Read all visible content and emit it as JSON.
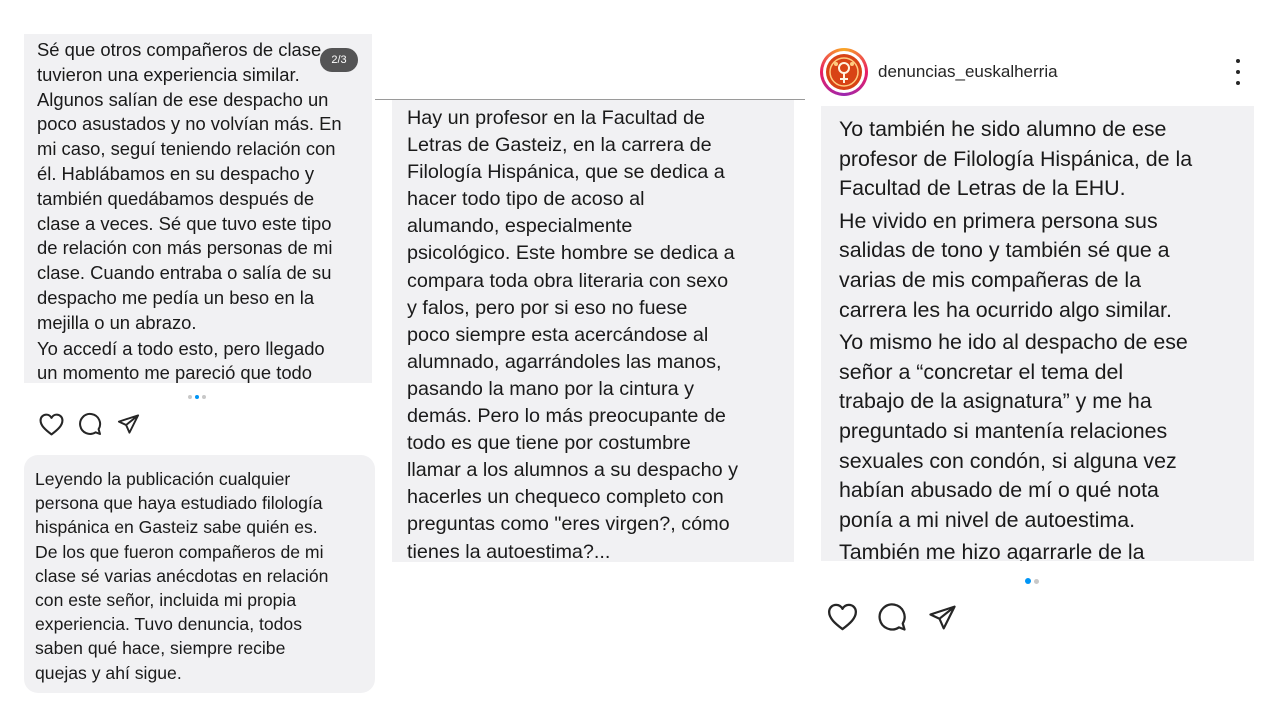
{
  "post_1": {
    "counter": "2/3",
    "text_a": "Sé que otros compañeros de clase\ntuvieron una experiencia similar.\nAlgunos salían de ese despacho un\npoco asustados y no volvían más. En\nmi caso, seguí teniendo relación con\nél. Hablábamos en su despacho y\ntambién quedábamos después de\nclase a veces. Sé que tuvo este tipo\nde relación con más personas de mi\nclase. Cuando entraba o salía de su\ndespacho me pedía un beso en la\nmejilla o un abrazo.",
    "text_b": "Yo accedí a todo esto, pero llegado\nun momento me pareció que todo",
    "carousel": {
      "count": 3,
      "active_index": 1
    },
    "actions": [
      "like-icon",
      "comment-icon",
      "share-icon"
    ]
  },
  "comment": {
    "text": "Leyendo la publicación cualquier\npersona que haya estudiado filología\nhispánica en Gasteiz sabe quién es.\nDe los que fueron compañeros de mi\nclase sé varias anécdotas en relación\ncon este señor, incluida mi propia\nexperiencia. Tuvo denuncia, todos\nsaben qué hace, siempre recibe\nquejas y ahí sigue."
  },
  "post_2": {
    "text": "Hay un profesor en la Facultad de\nLetras de Gasteiz, en la carrera de\nFilología Hispánica, que se dedica a\nhacer todo tipo de acoso al\nalumando, especialmente\npsicológico. Este hombre se dedica a\ncompara toda obra literaria con sexo\ny falos, pero por si eso no fuese\npoco siempre esta acercándose al\nalumnado, agarrándoles las manos,\npasando la mano por la cintura y\ndemás. Pero lo más preocupante de\ntodo es que tiene por costumbre\nllamar a los alumnos a su despacho y\nhacerles un chequeco completo con\npreguntas como \"eres virgen?, cómo\ntienes la autoestima?..."
  },
  "post_3": {
    "username": "denuncias_euskalherria",
    "text_a": "Yo también he sido alumno de ese\nprofesor de Filología Hispánica, de la\nFacultad de Letras de la EHU.",
    "text_b": "He vivido en primera persona sus\nsalidas de tono y también sé que a\nvarias de mis compañeras de la\ncarrera les ha ocurrido algo similar.",
    "text_c": "Yo mismo he ido al despacho de ese\nseñor a “concretar el tema del\ntrabajo de la asignatura” y me ha\npreguntado si mantenía relaciones\nsexuales con condón, si alguna vez\nhabían abusado de mí o qué nota\nponía a mi nivel de autoestima.",
    "text_d": "También me hizo agarrarle de la",
    "carousel": {
      "count": 2,
      "active_index": 0
    },
    "actions": [
      "like-icon",
      "comment-icon",
      "share-icon"
    ]
  },
  "colors": {
    "card_bg": "#f1f1f3",
    "text": "#1a1a1a",
    "accent_dot": "#0095f6",
    "inactive_dot": "#c8c8c8"
  }
}
